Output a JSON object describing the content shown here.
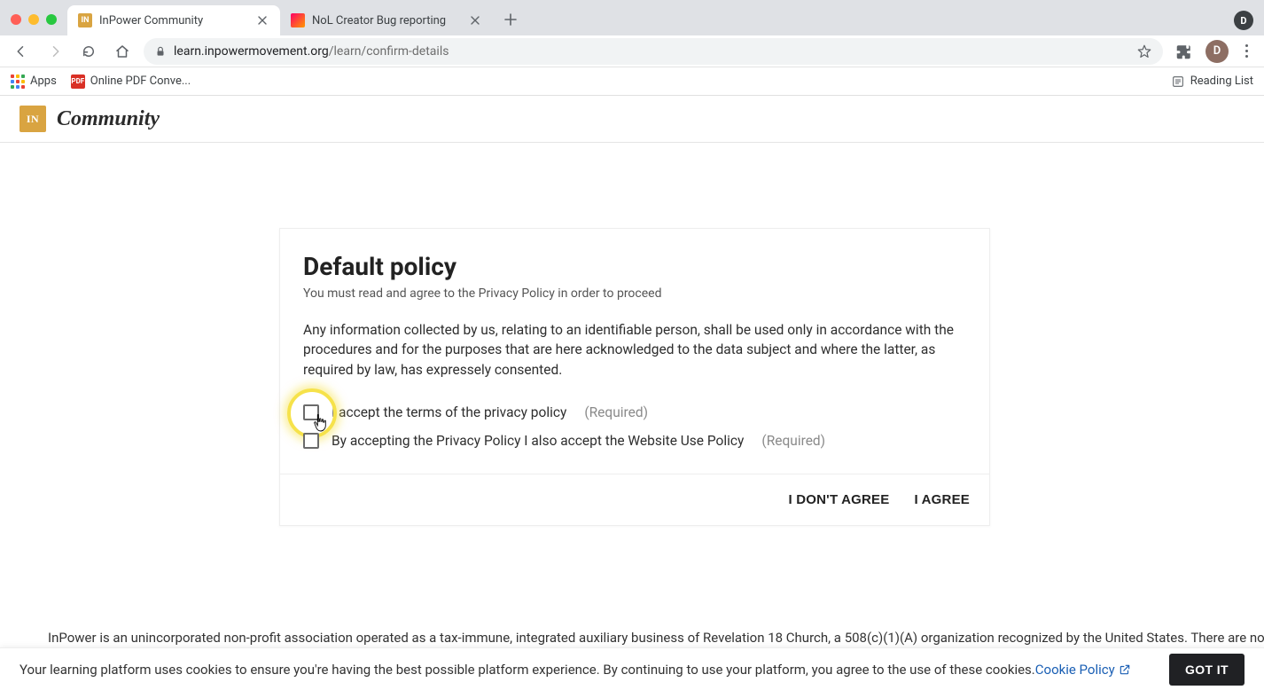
{
  "browser": {
    "tabs": [
      {
        "title": "InPower Community",
        "active": true,
        "favicon_bg": "#d9a441",
        "favicon_text": "IN"
      },
      {
        "title": "NoL Creator Bug reporting",
        "active": false,
        "favicon_bg": "#ffffff",
        "favicon_text": ""
      }
    ],
    "url_host": "learn.inpowermovement.org",
    "url_path": "/learn/confirm-details",
    "profile_initial": "D",
    "user_badge_initial": "D",
    "bookmarks": {
      "apps_label": "Apps",
      "pdf_label": "Online PDF Conve...",
      "reading_list": "Reading List"
    }
  },
  "app": {
    "logo_text": "IN",
    "header_title": "Community"
  },
  "policy_card": {
    "title": "Default policy",
    "subtitle": "You must read and agree to the Privacy Policy in order to proceed",
    "body": "Any information collected by us, relating to an identifiable person, shall be used only in accordance with the procedures and for the purposes that are here acknowledged to the data subject and where the latter, as required by law, has expressely consented.",
    "checkbox1_label": "I accept the terms of the privacy policy",
    "checkbox1_required": "(Required)",
    "checkbox2_label": "By accepting the Privacy Policy I also accept the Website Use Policy",
    "checkbox2_required": "(Required)",
    "dont_agree": "I DON'T AGREE",
    "agree": "I AGREE"
  },
  "footer_text": "InPower is an unincorporated non-profit association operated as a tax-immune, integrated auxiliary business of Revelation 18 Church, a 508(c)(1)(A) organization recognized by the United States. There are no",
  "cookie_bar": {
    "text": "Your learning platform uses cookies to ensure you're having the best possible platform experience. By continuing to use your platform, you agree to the use of these cookies.",
    "link": "Cookie Policy",
    "button": "GOT IT"
  }
}
